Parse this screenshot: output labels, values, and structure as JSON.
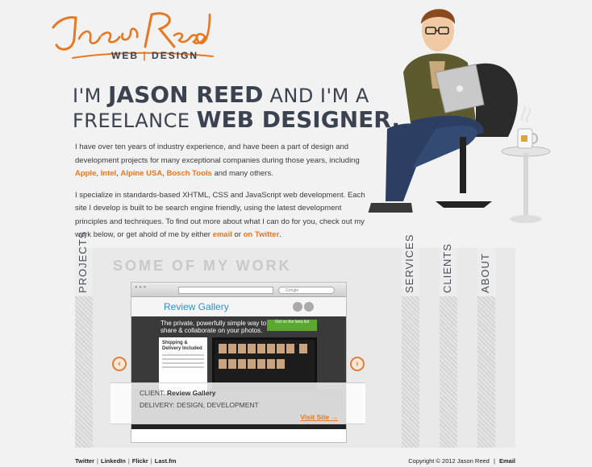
{
  "logo": {
    "script_text": "Jason Reed",
    "subtitle_left": "WEB",
    "subtitle_right": "DESIGN"
  },
  "headline": {
    "l1_pre": "I'M ",
    "l1_bold": "JASON REED",
    "l1_post": " AND I'M A",
    "l2_pre": "FREELANCE ",
    "l2_bold": "WEB DESIGNER",
    "l2_post": "."
  },
  "bio": {
    "p1_text": "I have over ten years of industry experience, and have been a part of design and development projects for many exceptional companies during those years, including ",
    "p1_links": [
      "Apple",
      "Intel",
      "Alpine USA",
      "Bosch Tools"
    ],
    "p1_end": " and many others.",
    "p2_text": "I specialize in standards-based XHTML, CSS and JavaScript web development. Each site I develop is built to be search engine friendly, using the latest development principles and techniques. To find out more about what I can do for you, check out my work below, or get ahold of me by either ",
    "p2_link_email": "email",
    "p2_or": " or ",
    "p2_link_twitter": "on Twitter",
    "p2_end": "."
  },
  "portfolio": {
    "title": "SOME OF MY WORK",
    "tabs": [
      "PROJECTS",
      "SERVICES",
      "CLIENTS",
      "ABOUT"
    ],
    "client_label": "CLIENT:",
    "client_name": "Review Gallery",
    "delivery_label": "DELIVERY:",
    "delivery_value": "DESIGN, DEVELOPMENT",
    "visit_label": "Visit Site →",
    "prev_icon": "left-arrow-icon",
    "next_icon": "right-arrow-icon",
    "screenshot": {
      "brand": "Review Gallery",
      "tagline_a": "The private, powerfully simple way to",
      "tagline_b": "share & collaborate on your photos.",
      "cta": "Get on the beta list",
      "card_title": "Shipping & Delivery Included",
      "search_placeholder": "Google"
    }
  },
  "footer": {
    "links": [
      "Twitter",
      "LinkedIn",
      "Flickr",
      "Last.fm"
    ],
    "copyright": "Copyright © 2012 Jason Reed",
    "email": "Email"
  },
  "colors": {
    "accent": "#e87722",
    "headline": "#3c4350",
    "background": "#f2f2f2"
  }
}
